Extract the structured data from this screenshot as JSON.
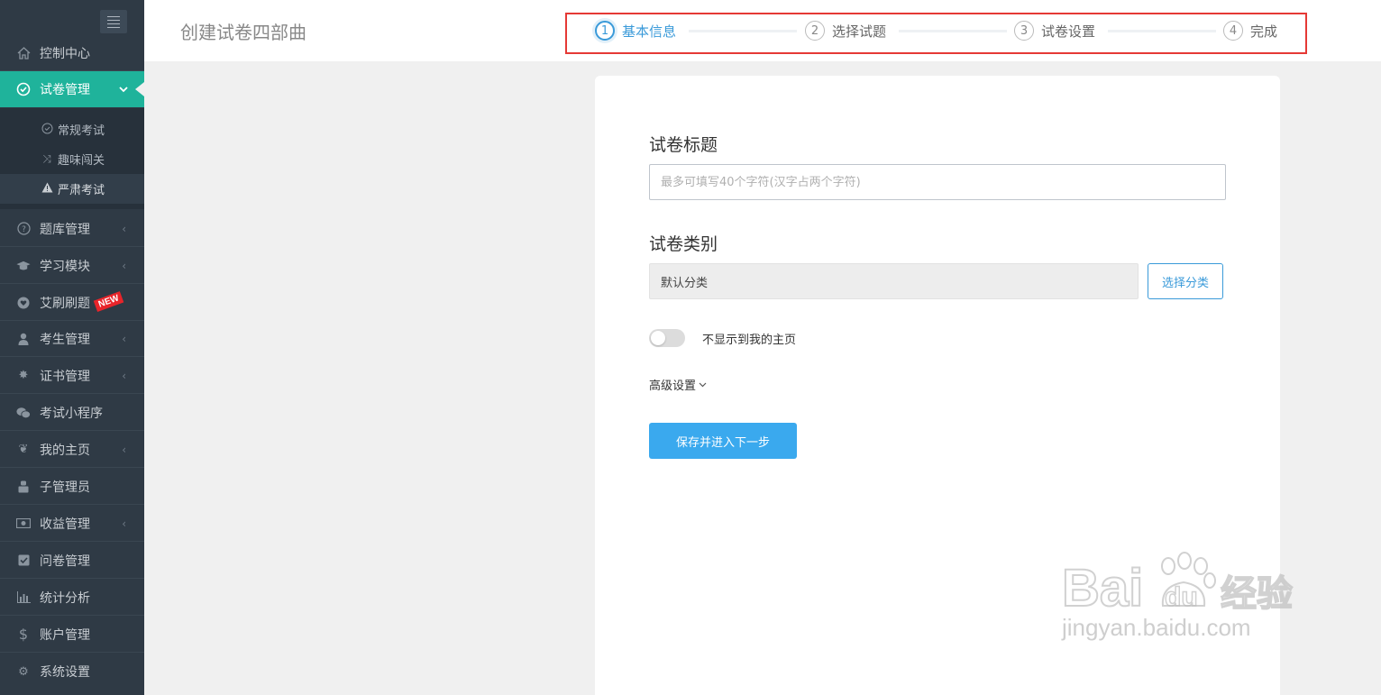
{
  "sidebar": {
    "items": [
      {
        "label": "控制中心",
        "icon": "home-icon"
      },
      {
        "label": "试卷管理",
        "icon": "check-circle-icon",
        "active": true
      },
      {
        "label": "题库管理",
        "icon": "question-circle-icon"
      },
      {
        "label": "学习模块",
        "icon": "graduation-cap-icon"
      },
      {
        "label": "艾刷刷题",
        "icon": "heart-icon",
        "badge": "NEW"
      },
      {
        "label": "考生管理",
        "icon": "user-icon"
      },
      {
        "label": "证书管理",
        "icon": "certificate-icon"
      },
      {
        "label": "考试小程序",
        "icon": "wechat-icon"
      },
      {
        "label": "我的主页",
        "icon": "leaf-icon"
      },
      {
        "label": "子管理员",
        "icon": "admin-icon"
      },
      {
        "label": "收益管理",
        "icon": "money-icon"
      },
      {
        "label": "问卷管理",
        "icon": "checkbox-icon"
      },
      {
        "label": "统计分析",
        "icon": "bar-chart-icon"
      },
      {
        "label": "账户管理",
        "icon": "dollar-icon"
      },
      {
        "label": "系统设置",
        "icon": "gear-icon"
      }
    ],
    "sub_items": [
      {
        "label": "常规考试",
        "icon": "check-circle-icon"
      },
      {
        "label": "趣味闯关",
        "icon": "shuffle-icon"
      },
      {
        "label": "严肃考试",
        "icon": "warning-icon"
      }
    ]
  },
  "header": {
    "title": "创建试卷四部曲",
    "steps": [
      {
        "num": "1",
        "label": "基本信息"
      },
      {
        "num": "2",
        "label": "选择试题"
      },
      {
        "num": "3",
        "label": "试卷设置"
      },
      {
        "num": "4",
        "label": "完成"
      }
    ]
  },
  "form": {
    "title_label": "试卷标题",
    "title_placeholder": "最多可填写40个字符(汉字占两个字符)",
    "category_label": "试卷类别",
    "category_value": "默认分类",
    "choose_category": "选择分类",
    "toggle_label": "不显示到我的主页",
    "advanced_label": "高级设置",
    "submit_label": "保存并进入下一步"
  },
  "watermark": {
    "logo": "Bai du 经验",
    "url": "jingyan.baidu.com"
  },
  "colors": {
    "sidebar_bg": "#2f3a45",
    "active_teal": "#1fb39b",
    "primary_blue": "#3aa9ee",
    "highlight_red": "#e53935"
  }
}
